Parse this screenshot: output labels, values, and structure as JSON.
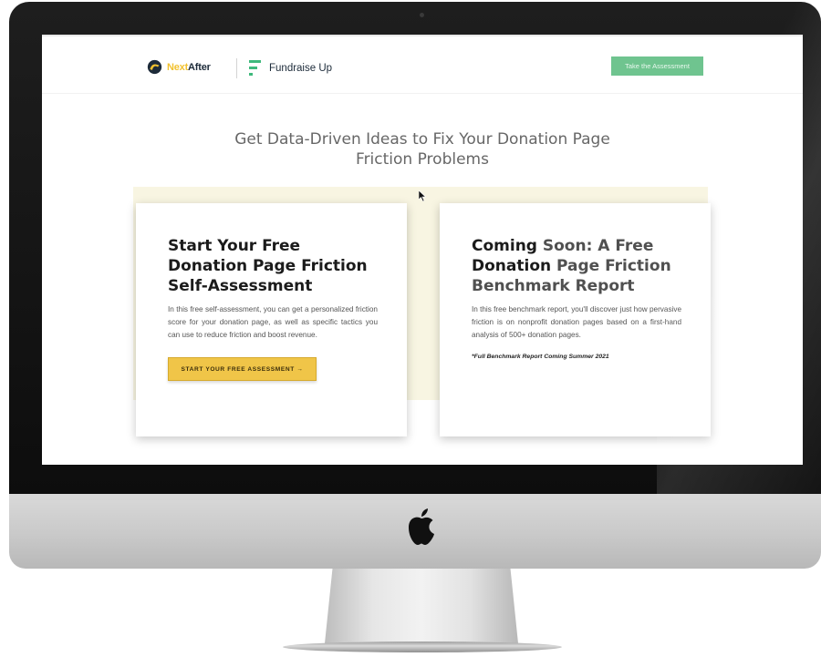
{
  "header": {
    "logo_next": "Next",
    "logo_after": "After",
    "partner_name": "Fundraise Up",
    "cta_label": "Take the Assessment"
  },
  "hero": {
    "headline_line1": "Get Data-Driven Ideas to Fix Your Donation Page",
    "headline_line2": "Friction Problems"
  },
  "cards": [
    {
      "title": "Start Your Free Donation Page Friction Self-Assessment",
      "body": "In this free self-assessment, you can get a personalized friction score for your donation page, as well as specific tactics you can use to reduce friction and boost revenue.",
      "button_label": "START YOUR FREE ASSESSMENT →"
    },
    {
      "title_a": "Coming",
      "title_b": " Soon: A Free ",
      "title_c": "Donation",
      "title_d": " Page Friction Benchmark Report",
      "body": "In this free benchmark report, you'll discover just how pervasive friction is on nonprofit donation pages based on a first-hand analysis of 500+ donation pages.",
      "note": "*Full Benchmark Report Coming Summer 2021"
    }
  ],
  "colors": {
    "accent_green": "#6fc48f",
    "accent_yellow": "#f0c548",
    "band_cream": "#f8f5e2"
  },
  "icons": [
    "nextafter-logo-icon",
    "fundraiseup-logo-icon",
    "apple-logo-icon",
    "mouse-cursor-icon"
  ]
}
